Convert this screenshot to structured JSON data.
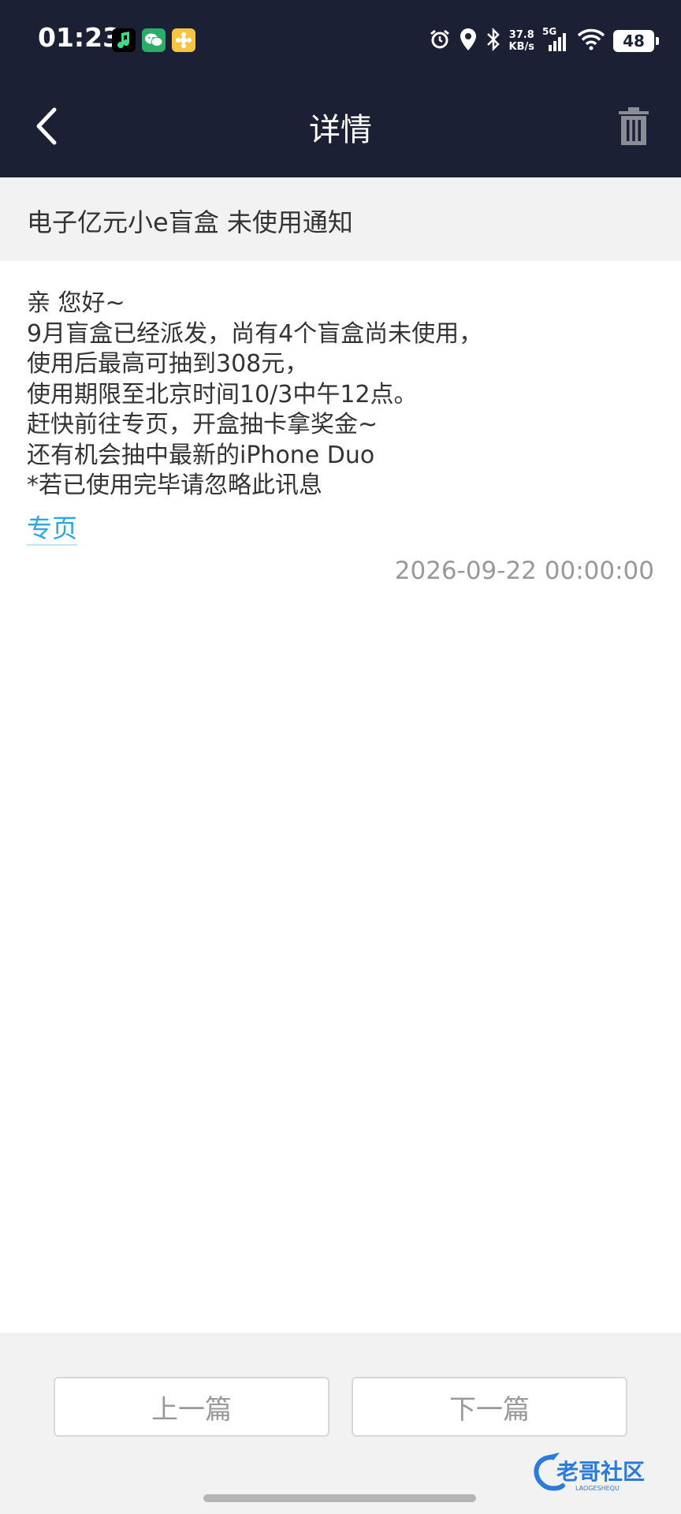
{
  "status_bar": {
    "time": "01:23",
    "net_speed_value": "37.8",
    "net_speed_unit": "KB/s",
    "network": "5G",
    "battery": "48",
    "icons": [
      "music-app-icon",
      "wechat-icon",
      "photo-app-icon",
      "alarm-icon",
      "location-icon",
      "bluetooth-icon",
      "signal-icon",
      "wifi-icon",
      "battery-icon"
    ]
  },
  "header": {
    "title": "详情"
  },
  "message": {
    "subject": "电子亿元小e盲盒 未使用通知",
    "lines": [
      "亲  您好~",
      "9月盲盒已经派发，尚有4个盲盒尚未使用，",
      "使用后最高可抽到308元，",
      "使用期限至北京时间10/3中午12点。",
      "赶快前往专页，开盒抽卡拿奖金~",
      "还有机会抽中最新的iPhone Duo",
      "*若已使用完毕请忽略此讯息"
    ],
    "link_label": "专页",
    "timestamp": "2026-09-22 00:00:00"
  },
  "navigation": {
    "prev_label": "上一篇",
    "next_label": "下一篇"
  },
  "watermark": {
    "text": "老哥社区",
    "subtext": "LAOGESHEQU"
  },
  "colors": {
    "header_bg": "#1c2035",
    "link": "#2aa6e0",
    "band_bg": "#f2f2f2"
  }
}
